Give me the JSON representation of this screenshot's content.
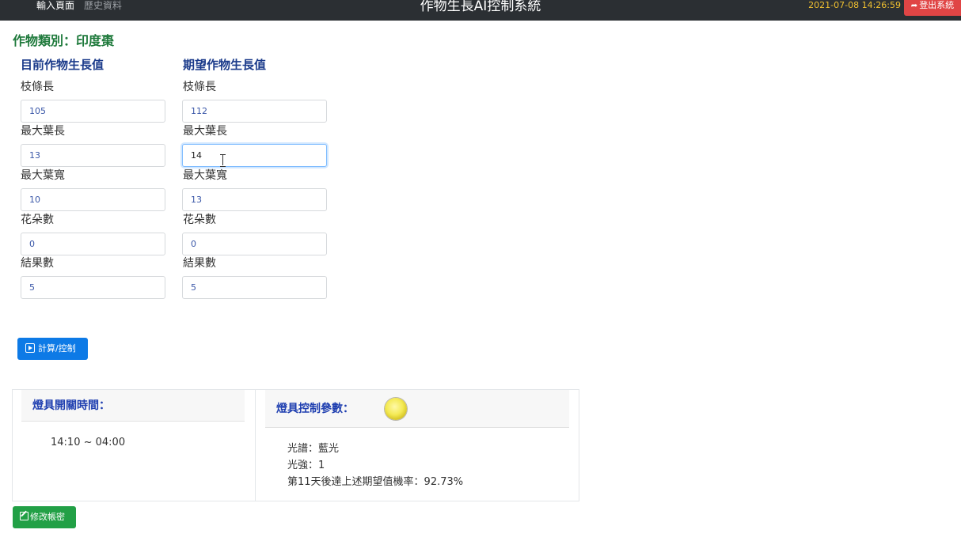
{
  "navbar": {
    "links": [
      "輸入頁面",
      "歷史資料"
    ],
    "title": "作物生長AI控制系統",
    "datetime": "2021-07-08 14:26:59",
    "logout_label": "登出系統"
  },
  "crop": {
    "label": "作物類別：",
    "value": "印度棗"
  },
  "current": {
    "heading": "目前作物生長值",
    "fields": [
      {
        "label": "枝條長",
        "value": "105"
      },
      {
        "label": "最大葉長",
        "value": "13"
      },
      {
        "label": "最大葉寬",
        "value": "10"
      },
      {
        "label": "花朵數",
        "value": "0"
      },
      {
        "label": "結果數",
        "value": "5"
      }
    ]
  },
  "expected": {
    "heading": "期望作物生長值",
    "fields": [
      {
        "label": "枝條長",
        "value": "112"
      },
      {
        "label": "最大葉長",
        "value": "14"
      },
      {
        "label": "最大葉寬",
        "value": "13"
      },
      {
        "label": "花朵數",
        "value": "0"
      },
      {
        "label": "結果數",
        "value": "5"
      }
    ]
  },
  "calc_button_label": "計算/控制",
  "light_schedule": {
    "title": "燈具開關時間：",
    "time_range": "14:10 ~ 04:00"
  },
  "light_params": {
    "title": "燈具控制參數：",
    "spectrum": "光譜：藍光",
    "intensity": "光強：1",
    "probability": "第11天後達上述期望值機率：92.73%"
  },
  "edit_account_label": "修改帳密",
  "colors": {
    "navbar": "#2b2f33",
    "logout": "#e04545",
    "primary_button": "#0d7ae6",
    "success_button": "#22a046",
    "crop_title": "#1f7a3c",
    "heading_blue": "#1a3a8a"
  },
  "icons": [
    "logout-icon",
    "play-icon",
    "light-bulb-icon",
    "edit-icon"
  ]
}
